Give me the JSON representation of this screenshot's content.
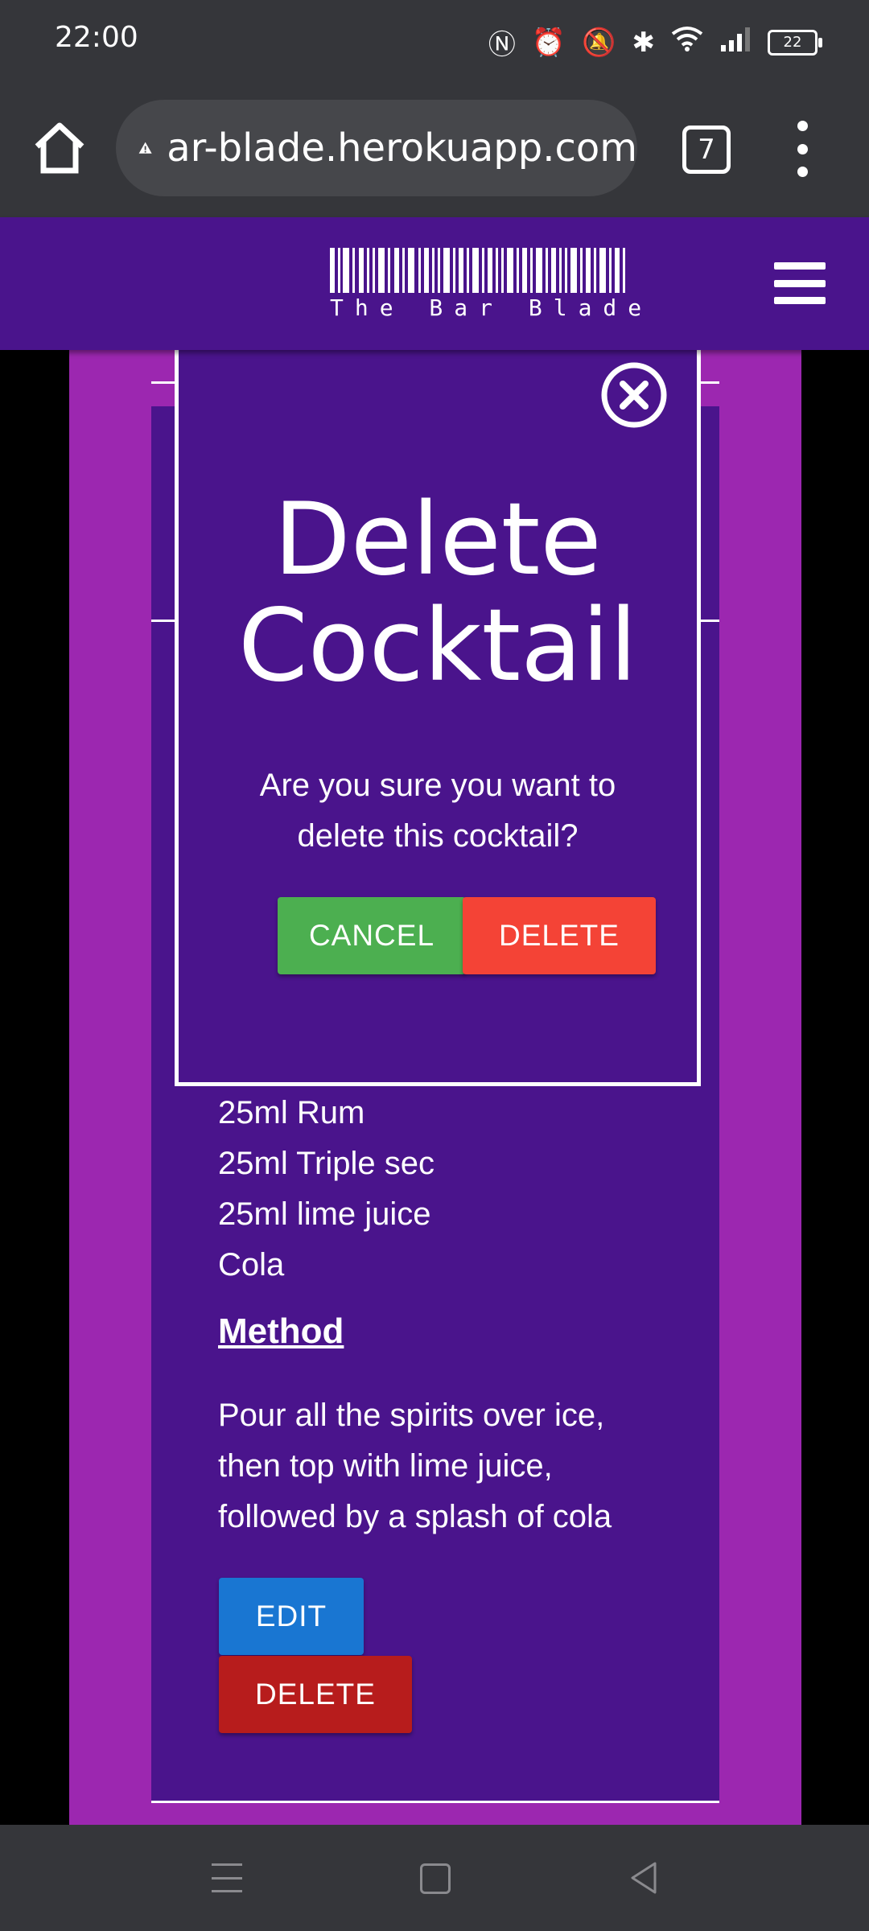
{
  "status_bar": {
    "time": "22:00",
    "battery": "22",
    "icons": [
      "nfc-icon",
      "alarm-icon",
      "mute-icon",
      "bluetooth-icon",
      "wifi-icon",
      "signal-icon",
      "battery-icon"
    ]
  },
  "browser": {
    "url": "ar-blade.herokuapp.com",
    "tab_count": "7"
  },
  "navbar": {
    "brand": "The Bar Blade"
  },
  "modal": {
    "title_line1": "Delete",
    "title_line2": "Cocktail",
    "message": "Are you sure you want to delete this cocktail?",
    "cancel_label": "CANCEL",
    "delete_label": "DELETE"
  },
  "cocktail": {
    "ingredients": [
      "25ml Rum",
      "25ml Triple sec",
      "25ml lime juice",
      "Cola"
    ],
    "method_heading": "Method",
    "method_text": "Pour all the spirits over ice, then top with lime juice, followed by a splash of cola",
    "edit_label": "EDIT",
    "delete_label": "DELETE"
  },
  "colors": {
    "navbar": "#4a148c",
    "page_bg": "#9c27b0",
    "cancel": "#4caf50",
    "confirm_delete": "#f44336",
    "edit": "#1976d2",
    "card_delete": "#b71c1c"
  }
}
